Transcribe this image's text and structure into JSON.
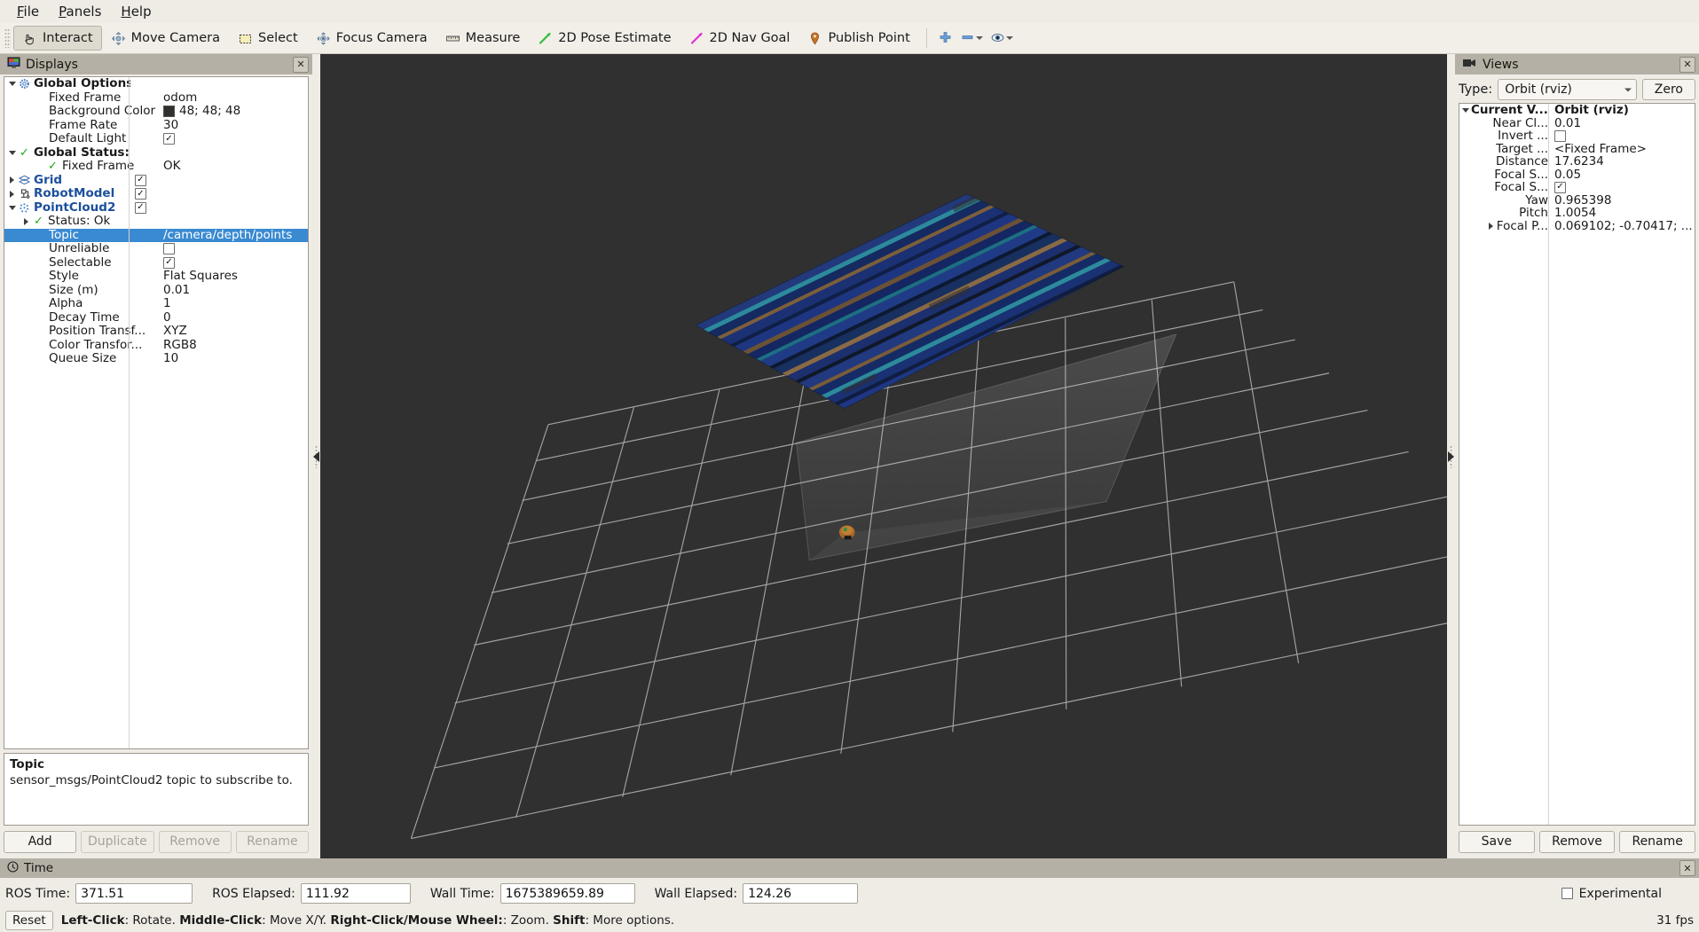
{
  "menu": {
    "items": [
      {
        "label": "File",
        "mnemonic": "F"
      },
      {
        "label": "Panels",
        "mnemonic": "P"
      },
      {
        "label": "Help",
        "mnemonic": "H"
      }
    ]
  },
  "toolbar": {
    "buttons": [
      {
        "label": "Interact",
        "icon": "hand-cursor-icon",
        "checked": true
      },
      {
        "label": "Move Camera",
        "icon": "move-camera-icon",
        "checked": false
      },
      {
        "label": "Select",
        "icon": "selection-rect-icon",
        "checked": false
      },
      {
        "label": "Focus Camera",
        "icon": "focus-camera-icon",
        "checked": false
      },
      {
        "label": "Measure",
        "icon": "ruler-icon",
        "checked": false
      },
      {
        "label": "2D Pose Estimate",
        "icon": "green-arrow-icon",
        "checked": false
      },
      {
        "label": "2D Nav Goal",
        "icon": "magenta-arrow-icon",
        "checked": false
      },
      {
        "label": "Publish Point",
        "icon": "map-pin-icon",
        "checked": false
      }
    ],
    "icon_buttons": [
      {
        "icon": "plus-icon",
        "has_dropdown": false
      },
      {
        "icon": "minus-icon",
        "has_dropdown": true
      },
      {
        "icon": "eye-icon",
        "has_dropdown": true
      }
    ]
  },
  "displays": {
    "title": "Displays",
    "close_label": "✕",
    "rows": [
      {
        "indent": 0,
        "expander": "down",
        "icon": "gear-icon",
        "name": "Global Options",
        "value": "",
        "value_type": "text",
        "style": "bold"
      },
      {
        "indent": 2,
        "expander": "none",
        "icon": "none",
        "name": "Fixed Frame",
        "value": "odom",
        "value_type": "text",
        "style": "normal"
      },
      {
        "indent": 2,
        "expander": "none",
        "icon": "none",
        "name": "Background Color",
        "value": "48; 48; 48",
        "value_type": "color",
        "color": "#303030",
        "style": "normal"
      },
      {
        "indent": 2,
        "expander": "none",
        "icon": "none",
        "name": "Frame Rate",
        "value": "30",
        "value_type": "text",
        "style": "normal"
      },
      {
        "indent": 2,
        "expander": "none",
        "icon": "none",
        "name": "Default Light",
        "value": "",
        "value_type": "checkbox",
        "checked": true,
        "style": "normal"
      },
      {
        "indent": 0,
        "expander": "down",
        "icon": "check-icon",
        "name": "Global Status: Ok",
        "value": "",
        "value_type": "text",
        "style": "bold"
      },
      {
        "indent": 2,
        "expander": "none",
        "icon": "check-icon",
        "name": "Fixed Frame",
        "value": "OK",
        "value_type": "text",
        "style": "normal"
      },
      {
        "indent": 0,
        "expander": "right",
        "icon": "grid-icon",
        "name": "Grid",
        "value": "",
        "value_type": "checkbox",
        "checked": true,
        "style": "link"
      },
      {
        "indent": 0,
        "expander": "right",
        "icon": "robot-icon",
        "name": "RobotModel",
        "value": "",
        "value_type": "checkbox",
        "checked": true,
        "style": "link"
      },
      {
        "indent": 0,
        "expander": "down",
        "icon": "pointcloud-icon",
        "name": "PointCloud2",
        "value": "",
        "value_type": "checkbox",
        "checked": true,
        "style": "link"
      },
      {
        "indent": 1,
        "expander": "right",
        "icon": "check-icon",
        "name": "Status: Ok",
        "value": "",
        "value_type": "text",
        "style": "normal"
      },
      {
        "indent": 2,
        "expander": "none",
        "icon": "none",
        "name": "Topic",
        "value": "/camera/depth/points",
        "value_type": "text",
        "style": "normal",
        "selected": true
      },
      {
        "indent": 2,
        "expander": "none",
        "icon": "none",
        "name": "Unreliable",
        "value": "",
        "value_type": "checkbox",
        "checked": false,
        "style": "normal"
      },
      {
        "indent": 2,
        "expander": "none",
        "icon": "none",
        "name": "Selectable",
        "value": "",
        "value_type": "checkbox",
        "checked": true,
        "style": "normal"
      },
      {
        "indent": 2,
        "expander": "none",
        "icon": "none",
        "name": "Style",
        "value": "Flat Squares",
        "value_type": "text",
        "style": "normal"
      },
      {
        "indent": 2,
        "expander": "none",
        "icon": "none",
        "name": "Size (m)",
        "value": "0.01",
        "value_type": "text",
        "style": "normal"
      },
      {
        "indent": 2,
        "expander": "none",
        "icon": "none",
        "name": "Alpha",
        "value": "1",
        "value_type": "text",
        "style": "normal"
      },
      {
        "indent": 2,
        "expander": "none",
        "icon": "none",
        "name": "Decay Time",
        "value": "0",
        "value_type": "text",
        "style": "normal"
      },
      {
        "indent": 2,
        "expander": "none",
        "icon": "none",
        "name": "Position Transf...",
        "value": "XYZ",
        "value_type": "text",
        "style": "normal"
      },
      {
        "indent": 2,
        "expander": "none",
        "icon": "none",
        "name": "Color Transfor...",
        "value": "RGB8",
        "value_type": "text",
        "style": "normal"
      },
      {
        "indent": 2,
        "expander": "none",
        "icon": "none",
        "name": "Queue Size",
        "value": "10",
        "value_type": "text",
        "style": "normal"
      }
    ],
    "help": {
      "title": "Topic",
      "text": "sensor_msgs/PointCloud2 topic to subscribe to."
    },
    "buttons": [
      {
        "label": "Add",
        "enabled": true
      },
      {
        "label": "Duplicate",
        "enabled": false
      },
      {
        "label": "Remove",
        "enabled": false
      },
      {
        "label": "Rename",
        "enabled": false
      }
    ]
  },
  "views": {
    "title": "Views",
    "close_label": "✕",
    "type_label": "Type:",
    "type_value": "Orbit (rviz)",
    "zero_label": "Zero",
    "rows": [
      {
        "indent": 0,
        "expander": "down",
        "name": "Current V...",
        "value": "Orbit (rviz)",
        "value_type": "text",
        "style": "bold"
      },
      {
        "indent": 1,
        "expander": "none",
        "name": "Near Cl...",
        "value": "0.01",
        "value_type": "text",
        "style": "normal"
      },
      {
        "indent": 1,
        "expander": "none",
        "name": "Invert ...",
        "value": "",
        "value_type": "checkbox",
        "checked": false,
        "style": "normal"
      },
      {
        "indent": 1,
        "expander": "none",
        "name": "Target ...",
        "value": "<Fixed Frame>",
        "value_type": "text",
        "style": "normal"
      },
      {
        "indent": 1,
        "expander": "none",
        "name": "Distance",
        "value": "17.6234",
        "value_type": "text",
        "style": "normal"
      },
      {
        "indent": 1,
        "expander": "none",
        "name": "Focal S...",
        "value": "0.05",
        "value_type": "text",
        "style": "normal"
      },
      {
        "indent": 1,
        "expander": "none",
        "name": "Focal S...",
        "value": "",
        "value_type": "checkbox",
        "checked": true,
        "style": "normal"
      },
      {
        "indent": 1,
        "expander": "none",
        "name": "Yaw",
        "value": "0.965398",
        "value_type": "text",
        "style": "normal"
      },
      {
        "indent": 1,
        "expander": "none",
        "name": "Pitch",
        "value": "1.0054",
        "value_type": "text",
        "style": "normal"
      },
      {
        "indent": 1,
        "expander": "right",
        "name": "Focal P...",
        "value": "0.069102; -0.70417; ...",
        "value_type": "text",
        "style": "normal"
      }
    ],
    "buttons": [
      {
        "label": "Save",
        "enabled": true
      },
      {
        "label": "Remove",
        "enabled": true
      },
      {
        "label": "Rename",
        "enabled": true
      }
    ]
  },
  "time": {
    "title": "Time",
    "fields": [
      {
        "label": "ROS Time:",
        "value": "371.51"
      },
      {
        "label": "ROS Elapsed:",
        "value": "111.92"
      },
      {
        "label": "Wall Time:",
        "value": "1675389659.89"
      },
      {
        "label": "Wall Elapsed:",
        "value": "124.26"
      }
    ],
    "experimental_label": "Experimental",
    "experimental_checked": false
  },
  "status": {
    "reset_label": "Reset",
    "hint_parts": [
      {
        "text": "Left-Click",
        "bold": true
      },
      {
        "text": ": Rotate. ",
        "bold": false
      },
      {
        "text": "Middle-Click",
        "bold": true
      },
      {
        "text": ": Move X/Y. ",
        "bold": false
      },
      {
        "text": "Right-Click/Mouse Wheel:",
        "bold": true
      },
      {
        "text": ": Zoom. ",
        "bold": false
      },
      {
        "text": "Shift",
        "bold": true
      },
      {
        "text": ": More options.",
        "bold": false
      }
    ],
    "fps": "31 fps"
  },
  "viewport": {
    "background_color": "#303030",
    "grid_color": "#bdbdbd",
    "pointcloud_colors": [
      "#1c2f6e",
      "#17305f",
      "#0f2146",
      "#1d6f82",
      "#2c8a9c",
      "#6b5236",
      "#8a6a45",
      "#101828"
    ],
    "robot_color": "#a86a2a",
    "frustum_color": "#c8c8c8"
  }
}
